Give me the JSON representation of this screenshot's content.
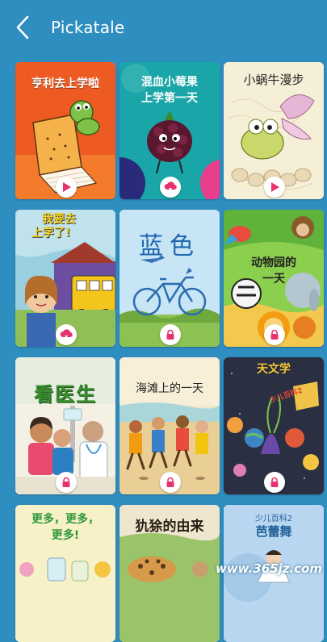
{
  "header": {
    "title": "Pickatale"
  },
  "books": [
    {
      "title": "亨利去上学啦",
      "status": "play"
    },
    {
      "title": "混血小莓果上学第一天",
      "line1": "混血小莓果",
      "line2": "上学第一天",
      "status": "download"
    },
    {
      "title": "小蜗牛漫步",
      "status": "play"
    },
    {
      "title": "我要去上学了!",
      "line1": "我要去",
      "line2": "上学了!",
      "status": "download"
    },
    {
      "title": "蓝色",
      "status": "locked"
    },
    {
      "title": "动物园的一天",
      "line1": "动物园的",
      "line2": "一天",
      "status": "locked"
    },
    {
      "title": "看医生",
      "status": "locked"
    },
    {
      "title": "海滩上的一天",
      "status": "locked"
    },
    {
      "title": "天文学",
      "subtitle": "少儿百科2",
      "status": "locked"
    },
    {
      "title": "更多，更多，更多!",
      "line1": "更多，更多，",
      "line2": "更多!",
      "status": "partial"
    },
    {
      "title": "犰狳的由来",
      "status": "partial"
    },
    {
      "title": "芭蕾舞",
      "subtitle": "少儿百科2",
      "status": "partial"
    }
  ],
  "watermark": "www.365jz.com",
  "colors": {
    "background": "#2f8ec0",
    "badge_accent": "#e8326e"
  }
}
